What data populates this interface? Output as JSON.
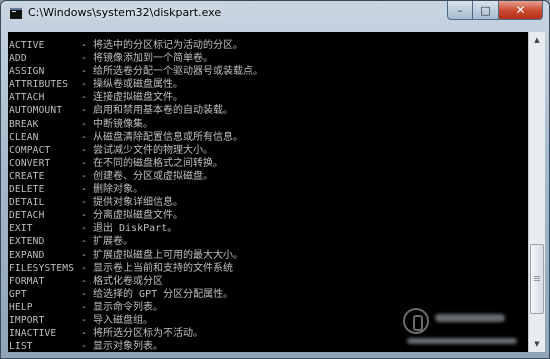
{
  "window": {
    "title": "C:\\Windows\\system32\\diskpart.exe",
    "controls": {
      "minimize": "–",
      "maximize": "□",
      "close": "✕"
    }
  },
  "console": {
    "lines": [
      {
        "cmd": "ACTIVE",
        "desc": "- 将选中的分区标记为活动的分区。"
      },
      {
        "cmd": "ADD",
        "desc": "- 将镜像添加到一个简单卷。"
      },
      {
        "cmd": "ASSIGN",
        "desc": "- 给所选卷分配一个驱动器号或装载点。"
      },
      {
        "cmd": "ATTRIBUTES",
        "desc": "- 操纵卷或磁盘属性。"
      },
      {
        "cmd": "ATTACH",
        "desc": "- 连接虚拟磁盘文件。"
      },
      {
        "cmd": "AUTOMOUNT",
        "desc": "- 启用和禁用基本卷的自动装载。"
      },
      {
        "cmd": "BREAK",
        "desc": "- 中断镜像集。"
      },
      {
        "cmd": "CLEAN",
        "desc": "- 从磁盘清除配置信息或所有信息。"
      },
      {
        "cmd": "COMPACT",
        "desc": "- 尝试减少文件的物理大小。"
      },
      {
        "cmd": "CONVERT",
        "desc": "- 在不同的磁盘格式之间转换。"
      },
      {
        "cmd": "CREATE",
        "desc": "- 创建卷、分区或虚拟磁盘。"
      },
      {
        "cmd": "DELETE",
        "desc": "- 删除对象。"
      },
      {
        "cmd": "DETAIL",
        "desc": "- 提供对象详细信息。"
      },
      {
        "cmd": "DETACH",
        "desc": "- 分离虚拟磁盘文件。"
      },
      {
        "cmd": "EXIT",
        "desc": "- 退出 DiskPart。"
      },
      {
        "cmd": "EXTEND",
        "desc": "- 扩展卷。"
      },
      {
        "cmd": "EXPAND",
        "desc": "- 扩展虚拟磁盘上可用的最大大小。"
      },
      {
        "cmd": "FILESYSTEMS",
        "desc": "- 显示卷上当前和支持的文件系统"
      },
      {
        "cmd": "FORMAT",
        "desc": "- 格式化卷或分区"
      },
      {
        "cmd": "GPT",
        "desc": "- 给选择的 GPT 分区分配属性。"
      },
      {
        "cmd": "HELP",
        "desc": "- 显示命令列表。"
      },
      {
        "cmd": "IMPORT",
        "desc": "- 导入磁盘组。"
      },
      {
        "cmd": "INACTIVE",
        "desc": "- 将所选分区标为不活动。"
      },
      {
        "cmd": "LIST",
        "desc": "- 显示对象列表。"
      }
    ]
  }
}
